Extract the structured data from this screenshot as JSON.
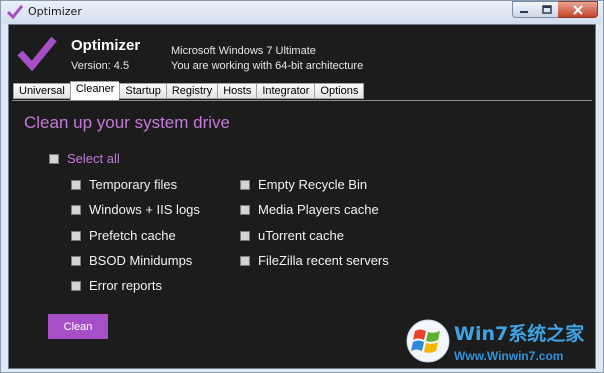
{
  "window": {
    "title": "Optimizer"
  },
  "header": {
    "app_name": "Optimizer",
    "version": "Version: 4.5",
    "os_line": "Microsoft Windows 7 Ultimate",
    "arch_line": "You are working with 64-bit architecture"
  },
  "tabs": [
    {
      "label": "Universal",
      "active": false
    },
    {
      "label": "Cleaner",
      "active": true
    },
    {
      "label": "Startup",
      "active": false
    },
    {
      "label": "Registry",
      "active": false
    },
    {
      "label": "Hosts",
      "active": false
    },
    {
      "label": "Integrator",
      "active": false
    },
    {
      "label": "Options",
      "active": false
    }
  ],
  "cleaner": {
    "heading": "Clean up your system drive",
    "select_all": "Select all",
    "left_options": [
      "Temporary files",
      "Windows + IIS logs",
      "Prefetch cache",
      "BSOD Minidumps",
      "Error reports"
    ],
    "right_options": [
      "Empty Recycle Bin",
      "Media Players cache",
      "uTorrent cache",
      "FileZilla recent servers"
    ],
    "clean_button": "Clean"
  },
  "watermark": {
    "brand": "Win7系统之家",
    "url": "Www.Winwin7.com"
  },
  "colors": {
    "accent_purple": "#a64fc7",
    "heading_purple": "#c47ad8",
    "background_dark": "#1c1c1c"
  }
}
